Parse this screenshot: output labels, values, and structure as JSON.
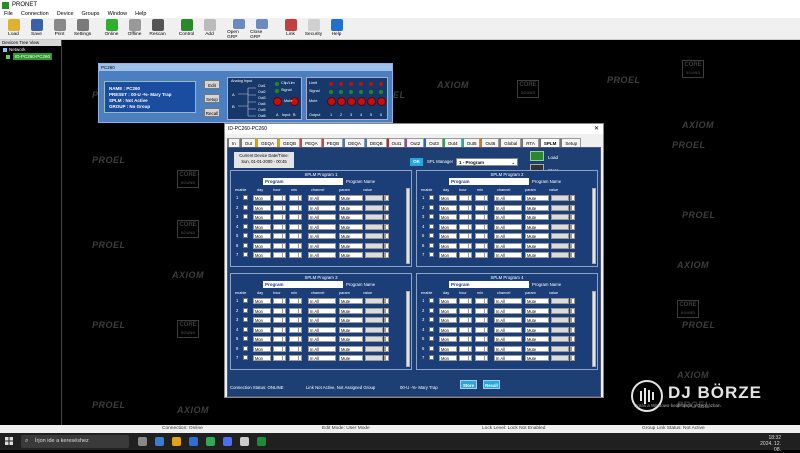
{
  "app": {
    "title": "PRONET"
  },
  "menu": [
    "File",
    "Connection",
    "Device",
    "Groups",
    "Window",
    "Help"
  ],
  "toolbar": [
    {
      "label": "Load",
      "icon": "folder-icon",
      "color": "#e0b030"
    },
    {
      "label": "Save",
      "icon": "floppy-icon",
      "color": "#3b5fa8"
    },
    {
      "label": "Print",
      "icon": "printer-icon",
      "color": "#888888"
    },
    {
      "label": "Settings",
      "icon": "tools-icon",
      "color": "#7a7a7a"
    },
    {
      "label": "Online",
      "icon": "monitor-online-icon",
      "color": "#2fae2f"
    },
    {
      "label": "Offline",
      "icon": "monitor-offline-icon",
      "color": "#999999"
    },
    {
      "label": "Rescan",
      "icon": "magnifier-icon",
      "color": "#555555"
    },
    {
      "label": "Control",
      "icon": "control-panel-icon",
      "color": "#2a8a2a"
    },
    {
      "label": "Add",
      "icon": "add-device-icon",
      "color": "#bbbbbb"
    },
    {
      "label": "Open GRP",
      "icon": "open-group-icon",
      "color": "#6a8ac0"
    },
    {
      "label": "Close GRP",
      "icon": "close-group-icon",
      "color": "#6a8ac0"
    },
    {
      "label": "Link",
      "icon": "link-icon",
      "color": "#c04040"
    },
    {
      "label": "Security",
      "icon": "shield-icon",
      "color": "#d0d0d0"
    },
    {
      "label": "Help",
      "icon": "help-icon",
      "color": "#2070d0"
    }
  ],
  "tree": {
    "header": "Devices Tree View",
    "root": "Network",
    "item": "ID-PC260-PC260"
  },
  "watermarks": {
    "proel": "PROEL",
    "axiom": "AXIOM",
    "core": "CORE",
    "sound": "SOUND"
  },
  "device_panel": {
    "title": "PC260",
    "info": [
      "NAME : PC260",
      "PRESET : 00-U -%- Mary Trap",
      "SPLM : Not Active",
      "GROUP : No Group"
    ],
    "buttons": [
      "Edit",
      "Setup",
      "Recall"
    ],
    "analog_title": "Analog Input",
    "channels": [
      "A",
      "B"
    ],
    "outs": [
      "Out1",
      "Out2",
      "Out3",
      "Out4",
      "Out5",
      "Out6"
    ],
    "in_labels": [
      "Clip/Lim",
      "Signal",
      "Mute"
    ],
    "input_label": "Input",
    "out_labels": [
      "Limit",
      "Signal",
      "Mute",
      "Output"
    ],
    "out_numbers": [
      "1",
      "2",
      "3",
      "4",
      "5",
      "6"
    ]
  },
  "main_window": {
    "title": "ID-PC260-PC260",
    "tabs": [
      "In",
      "Out",
      "GEQA",
      "GEQB",
      "PEQA",
      "PEQB",
      "DEQA",
      "DEQB",
      "Out1",
      "Out2",
      "Out3",
      "Out4",
      "Out5",
      "Out6",
      "Global",
      "RTA",
      "SPLM",
      "Setup"
    ],
    "tab_colors": [
      "#777777",
      "#777777",
      "#d4aa00",
      "#d4aa00",
      "#cc4444",
      "#cc4444",
      "#4477cc",
      "#4477cc",
      "#cc2222",
      "#9944bb",
      "#2266cc",
      "#22aa44",
      "#22aaaa",
      "#cc7722",
      "#777777",
      "#777777",
      "#777777",
      "#777777"
    ],
    "active_tab": "SPLM",
    "current_date_label": "Current Device Date/Time:",
    "current_date": "Sun, 01-01-2000 - 00:45",
    "ok": "OK",
    "spl_manager_label": "SPL Manager",
    "spl_manager_value": "1 - Program",
    "load": "Load",
    "store": "Store",
    "programs": [
      {
        "title": "SPLM Program 1",
        "name": "Program",
        "name_label": "Program Name"
      },
      {
        "title": "SPLM Program 2",
        "name": "Program",
        "name_label": "Program Name"
      },
      {
        "title": "SPLM Program 3",
        "name": "Program",
        "name_label": "Program Name"
      },
      {
        "title": "SPLM Program 4",
        "name": "Program",
        "name_label": "Program Name"
      }
    ],
    "columns": [
      "enable",
      "day",
      "hour",
      "min",
      "channel",
      "param",
      "value"
    ],
    "row_defaults": {
      "day": "Mon",
      "channel": "In All",
      "param": "Mute"
    },
    "row_numbers": [
      "1",
      "2",
      "3",
      "4",
      "5",
      "6",
      "7"
    ],
    "status": "Connection Status: ONLINE",
    "link_status": "Link Not Active,  Not Assigned Group",
    "preset": "00-U -%- Mary Trap",
    "store_btn": "Store",
    "recall_btn": "Recall"
  },
  "app_status": {
    "connection": "Connection: Online",
    "edit_mode": "Edit Mode: User Mode",
    "lock": "Lock Level: Lock Not Enabled",
    "group_link": "Group Link Status: Not Active"
  },
  "taskbar": {
    "search": "Írjon ide a kereséshez",
    "time": "18:32",
    "date": "2024. 12. 08."
  },
  "overlay": {
    "logo": "DJ BÖRZE",
    "activation": "Ugrás a Windows-beállítások a Gépházban."
  }
}
